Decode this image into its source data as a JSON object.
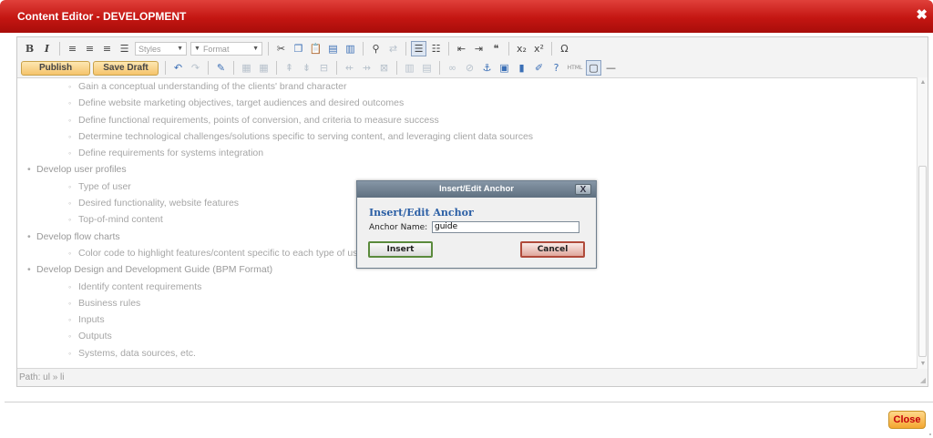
{
  "window": {
    "title": "Content Editor - DEVELOPMENT",
    "close_glyph": "✖"
  },
  "toolbar": {
    "row1": {
      "bold": "B",
      "italic": "I",
      "styles_label": "Styles",
      "format_label": "Format",
      "icons": [
        "bold-icon",
        "italic-icon",
        "align-left-icon",
        "align-center-icon",
        "align-right-icon",
        "align-justify-icon",
        "cut-icon",
        "copy-icon",
        "paste-icon",
        "paste-text-icon",
        "paste-word-icon",
        "find-icon",
        "replace-icon",
        "bullet-list-icon",
        "numbered-list-icon",
        "outdent-icon",
        "indent-icon",
        "blockquote-icon",
        "subscript-icon",
        "superscript-icon",
        "special-char-icon"
      ]
    },
    "row2": {
      "publish_label": "Publish",
      "save_draft_label": "Save Draft",
      "html_label": "HTML"
    }
  },
  "content": {
    "items": [
      {
        "level": 2,
        "text": "Gain a conceptual understanding of the clients' brand character"
      },
      {
        "level": 2,
        "text": "Define website marketing objectives, target audiences and desired outcomes"
      },
      {
        "level": 2,
        "text": "Define functional requirements, points of conversion, and criteria to measure success"
      },
      {
        "level": 2,
        "text": "Determine technological challenges/solutions specific to serving content, and leveraging client data sources"
      },
      {
        "level": 2,
        "text": "Define requirements for systems integration"
      },
      {
        "level": 1,
        "text": "Develop user profiles"
      },
      {
        "level": 2,
        "text": "Type of user"
      },
      {
        "level": 2,
        "text": "Desired functionality, website features"
      },
      {
        "level": 2,
        "text": "Top-of-mind content"
      },
      {
        "level": 1,
        "text": "Develop flow charts"
      },
      {
        "level": 2,
        "text": "Color code to highlight features/content specific to each type of us"
      },
      {
        "level": 1,
        "text": "Develop Design and Development Guide (BPM Format)"
      },
      {
        "level": 2,
        "text": "Identify content requirements"
      },
      {
        "level": 2,
        "text": "Business rules"
      },
      {
        "level": 2,
        "text": "Inputs"
      },
      {
        "level": 2,
        "text": "Outputs"
      },
      {
        "level": 2,
        "text": "Systems, data sources, etc."
      }
    ]
  },
  "path_bar": "Path: ul » li",
  "dialog": {
    "window_title": "Insert/Edit Anchor",
    "heading": "Insert/Edit Anchor",
    "anchor_label": "Anchor Name:",
    "anchor_value": "guide",
    "insert_label": "Insert",
    "cancel_label": "Cancel",
    "close_glyph": "X"
  },
  "footer": {
    "close_label": "Close"
  },
  "colors": {
    "titlebar": "#c41612",
    "accent_orange": "#f4a631",
    "dialog_header": "#6f8090",
    "close_text": "#c4000b"
  }
}
